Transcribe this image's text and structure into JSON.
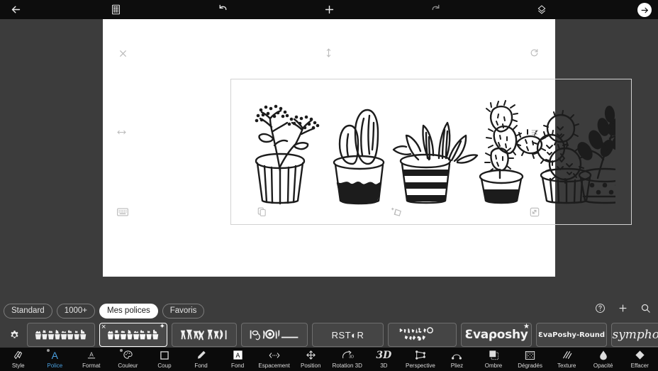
{
  "topbar": {
    "back_icon": "arrow-left-icon",
    "grid_icon": "keyboard-grid-icon",
    "undo_icon": "undo-icon",
    "add_icon": "plus-icon",
    "redo_icon": "redo-icon",
    "layers_icon": "layers-icon",
    "next_icon": "arrow-right-circle-icon"
  },
  "canvas": {
    "mode_label": "Police",
    "artwork_description": "Six hand-drawn potted cactus and plant illustrations in black line art",
    "handles": {
      "top_left": "close-handle",
      "top_center": "flip-vertical-handle",
      "top_right": "rotate-handle",
      "middle_left": "resize-horizontal-handle",
      "middle_right": "align-handle",
      "bottom_left": "keyboard-handle",
      "bottom_center": "duplicate-handle",
      "bottom_center_right": "add-shape-handle",
      "bottom_right": "scale-handle"
    }
  },
  "font_panel": {
    "tabs": [
      {
        "label": "Standard",
        "active": false
      },
      {
        "label": "1000+",
        "active": false
      },
      {
        "label": "Mes polices",
        "active": true
      },
      {
        "label": "Favoris",
        "active": false
      }
    ],
    "actions": [
      {
        "name": "help-icon",
        "label": "?"
      },
      {
        "name": "add-font-icon",
        "label": "+"
      },
      {
        "name": "search-fonts-icon",
        "label": "search"
      }
    ],
    "settings_icon": "gear-icon",
    "fonts": [
      {
        "id": "cactus-a",
        "label": "",
        "style": "dingbats",
        "selected": false,
        "preview": "dingbat-cactus"
      },
      {
        "id": "cactus-b",
        "label": "",
        "style": "dingbats",
        "selected": true,
        "preview": "dingbat-cactus",
        "delete_badge": "×",
        "favorite_badge": "✦"
      },
      {
        "id": "figures",
        "label": "",
        "style": "dingbats",
        "selected": false,
        "preview": "dingbat-figures"
      },
      {
        "id": "symbols",
        "label": "",
        "style": "dingbats",
        "selected": false,
        "preview": "dingbat-symbols"
      },
      {
        "id": "rstor",
        "label": "RST◐R",
        "style": "rst",
        "selected": false,
        "preview": "text"
      },
      {
        "id": "glyphs",
        "label": "",
        "style": "dingbats",
        "selected": false,
        "preview": "dingbat-glyphs"
      },
      {
        "id": "evaposhy",
        "label": "Ɛvaρoshy",
        "style": "eva",
        "selected": false,
        "preview": "text",
        "favorite_badge": "★"
      },
      {
        "id": "evaposhy-round",
        "label": "ƐvaPoshy-Round",
        "style": "evar",
        "selected": false,
        "preview": "text"
      },
      {
        "id": "symphony",
        "label": "symphony",
        "style": "sym",
        "selected": false,
        "preview": "text"
      }
    ]
  },
  "bottom_toolbar": {
    "items": [
      {
        "label": "Style",
        "icon": "style-icon",
        "active": false,
        "dot": false
      },
      {
        "label": "Police",
        "icon": "font-a-icon",
        "active": true,
        "dot": true
      },
      {
        "label": "Format",
        "icon": "format-underline-icon",
        "active": false,
        "dot": false
      },
      {
        "label": "Couleur",
        "icon": "palette-icon",
        "active": false,
        "dot": true
      },
      {
        "label": "Coup",
        "icon": "square-outline-icon",
        "active": false,
        "dot": false
      },
      {
        "label": "Fond",
        "icon": "pencil-icon",
        "active": false,
        "dot": false
      },
      {
        "label": "Fond",
        "icon": "boxed-a-icon",
        "active": false,
        "dot": false
      },
      {
        "label": "Espacement",
        "icon": "letter-spacing-icon",
        "active": false,
        "dot": false
      },
      {
        "label": "Position",
        "icon": "move-arrows-icon",
        "active": false,
        "dot": false
      },
      {
        "label": "Rotation 3D",
        "icon": "rotate-3d-icon",
        "active": false,
        "dot": false
      },
      {
        "label": "3D",
        "icon": "text-3d-icon",
        "active": false,
        "dot": false
      },
      {
        "label": "Perspective",
        "icon": "perspective-icon",
        "active": false,
        "dot": false
      },
      {
        "label": "Pliez",
        "icon": "bend-arc-icon",
        "active": false,
        "dot": false
      },
      {
        "label": "Ombre",
        "icon": "shadow-icon",
        "active": false,
        "dot": false
      },
      {
        "label": "Dégradés",
        "icon": "gradient-icon",
        "active": false,
        "dot": false
      },
      {
        "label": "Texture",
        "icon": "texture-hatch-icon",
        "active": false,
        "dot": false
      },
      {
        "label": "Opacité",
        "icon": "opacity-drop-icon",
        "active": false,
        "dot": false
      },
      {
        "label": "Effacer",
        "icon": "eraser-icon",
        "active": false,
        "dot": false
      }
    ]
  },
  "colors": {
    "app_bg": "#3c3c3c",
    "topbar_bg": "#0d0d0d",
    "bottombar_bg": "#0b0b0b",
    "canvas_bg": "#ffffff",
    "accent": "#4a9fe0",
    "chip_active_bg": "#ffffff",
    "label_pill_bg": "#7a7a7a"
  }
}
